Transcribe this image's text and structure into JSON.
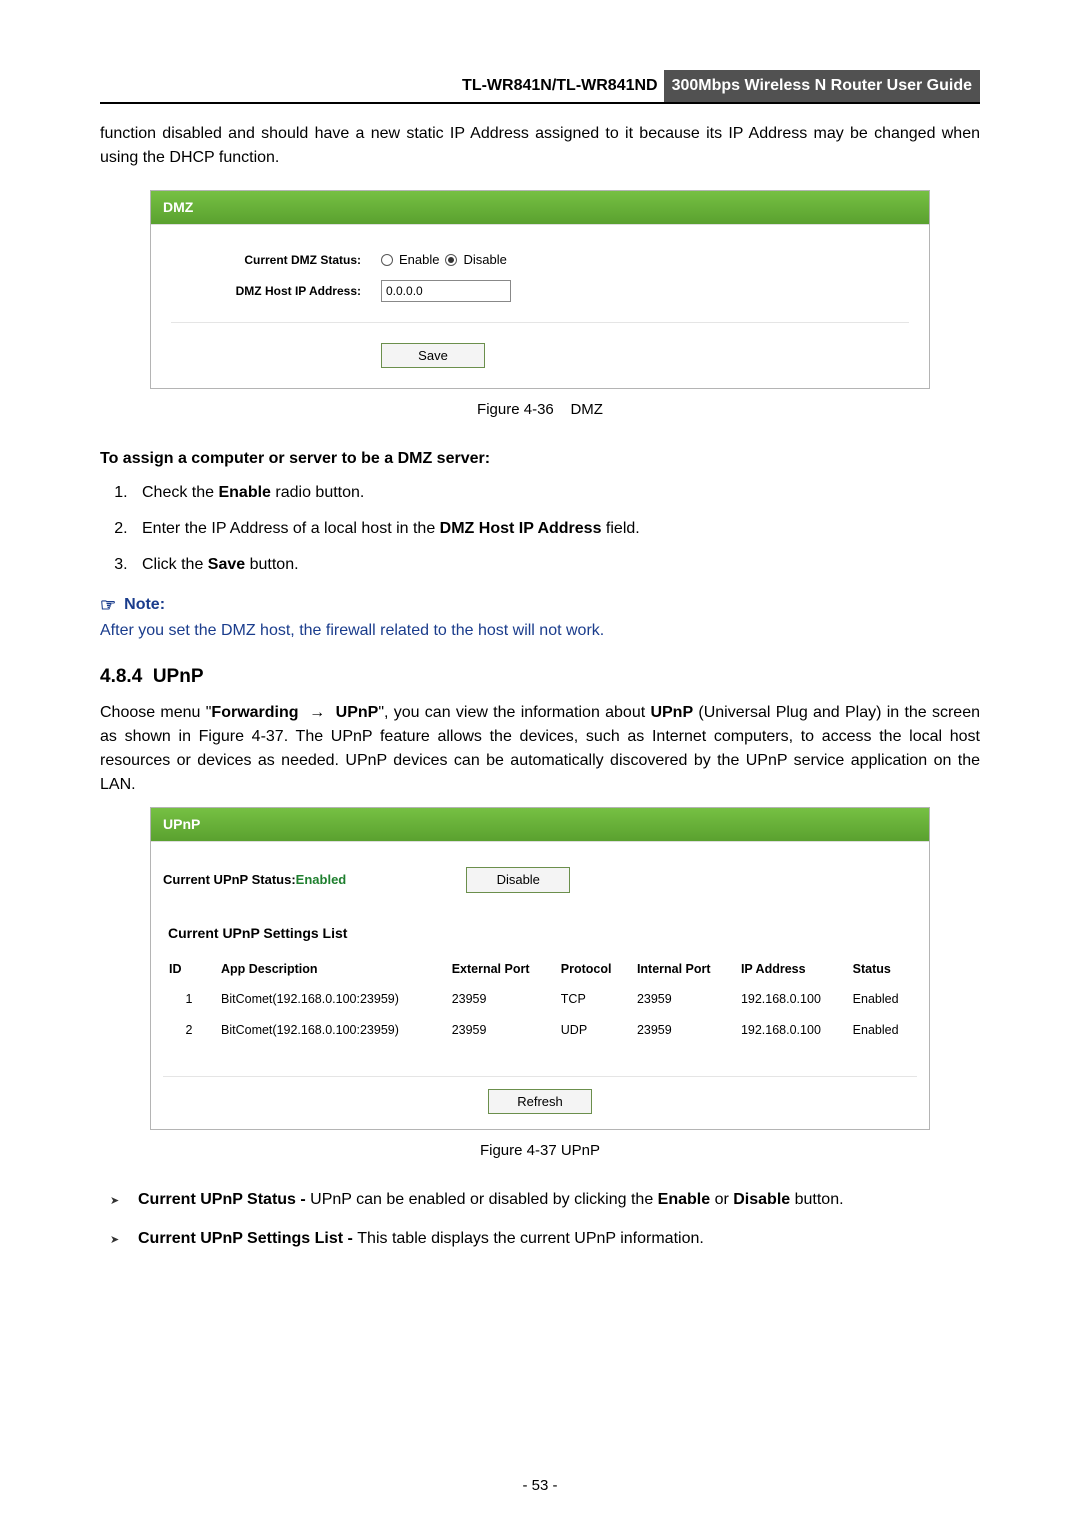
{
  "header": {
    "model": "TL-WR841N/TL-WR841ND",
    "title": "300Mbps Wireless N Router User Guide"
  },
  "intro": "function disabled and should have a new static IP Address assigned to it because its IP Address may be changed when using the DHCP function.",
  "dmz": {
    "panel_title": "DMZ",
    "status_label": "Current DMZ Status:",
    "enable": "Enable",
    "disable": "Disable",
    "ip_label": "DMZ Host IP Address:",
    "ip_value": "0.0.0.0",
    "save": "Save",
    "caption_pre": "Figure 4-36",
    "caption_sub": "DMZ"
  },
  "assign": {
    "heading": "To assign a computer or server to be a DMZ server:",
    "steps": {
      "s1a": "Check the ",
      "s1b": "Enable",
      "s1c": " radio button.",
      "s2a": "Enter the IP Address of a local host in the ",
      "s2b": "DMZ Host IP Address",
      "s2c": " field.",
      "s3a": "Click the ",
      "s3b": "Save",
      "s3c": " button."
    }
  },
  "note": {
    "label": "Note:",
    "text": "After you set the DMZ host, the firewall related to the host will not work."
  },
  "upnp": {
    "heading_no": "4.8.4",
    "heading": "UPnP",
    "desc_parts": {
      "p1": "Choose menu \"",
      "p2": "Forwarding",
      "arrow": "→",
      "p3": "UPnP",
      "p4": "\", you can view the information about ",
      "p5": "UPnP",
      "p6": " (Universal Plug and Play) in the screen as shown in Figure 4-37. The UPnP feature allows the devices, such as Internet computers, to access the local host resources or devices as needed. UPnP devices can be automatically discovered by the UPnP service application on the LAN."
    },
    "panel_title": "UPnP",
    "status_label": "Current UPnP Status: ",
    "status_value": "Enabled",
    "disable_btn": "Disable",
    "list_title": "Current UPnP Settings List",
    "cols": {
      "id": "ID",
      "app": "App Description",
      "ext": "External Port",
      "proto": "Protocol",
      "intp": "Internal Port",
      "ip": "IP Address",
      "status": "Status"
    },
    "rows": [
      {
        "id": "1",
        "app": "BitComet(192.168.0.100:23959)",
        "ext": "23959",
        "proto": "TCP",
        "intp": "23959",
        "ip": "192.168.0.100",
        "status": "Enabled"
      },
      {
        "id": "2",
        "app": "BitComet(192.168.0.100:23959)",
        "ext": "23959",
        "proto": "UDP",
        "intp": "23959",
        "ip": "192.168.0.100",
        "status": "Enabled"
      }
    ],
    "refresh": "Refresh",
    "caption": "Figure 4-37 UPnP"
  },
  "bullets": {
    "b1a": "Current UPnP Status - ",
    "b1b": "UPnP can be enabled or disabled by clicking the ",
    "b1c": "Enable",
    "b1d": " or ",
    "b1e": "Disable",
    "b1f": " button.",
    "b2a": "Current UPnP Settings List - ",
    "b2b": "This table displays the current UPnP information."
  },
  "page_number": "- 53 -"
}
